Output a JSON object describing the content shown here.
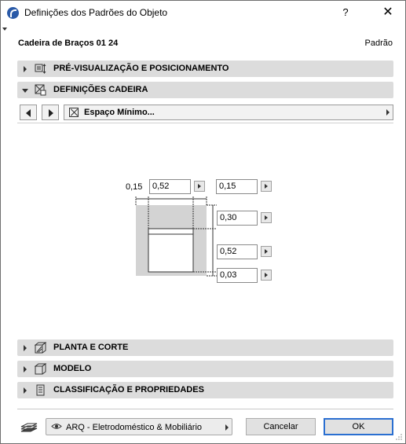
{
  "window": {
    "title": "Definições dos Padrões do Objeto",
    "help_label": "?",
    "close_label": "✕"
  },
  "object": {
    "name": "Cadeira de Braços 01 24",
    "default_label": "Padrão"
  },
  "sections": {
    "preview": "PRÉ-VISUALIZAÇÃO E POSICIONAMENTO",
    "settings": "DEFINIÇÕES CADEIRA",
    "plan": "PLANTA E CORTE",
    "model": "MODELO",
    "classification": "CLASSIFICAÇÃO E PROPRIEDADES"
  },
  "page_nav": {
    "current_page": "Espaço Mínimo..."
  },
  "parameters": {
    "left_clearance": "0,15",
    "width": "0,52",
    "right_clearance": "0,15",
    "back_clearance": "0,30",
    "depth": "0,52",
    "front_clearance": "0,03"
  },
  "footer": {
    "layer": "ARQ - Eletrodoméstico & Mobiliário",
    "cancel_label": "Cancelar",
    "ok_label": "OK"
  },
  "colors": {
    "section_bar": "#dcdcdc",
    "clearance_area": "#d3d3d3",
    "ok_border": "#2a6fd1"
  }
}
